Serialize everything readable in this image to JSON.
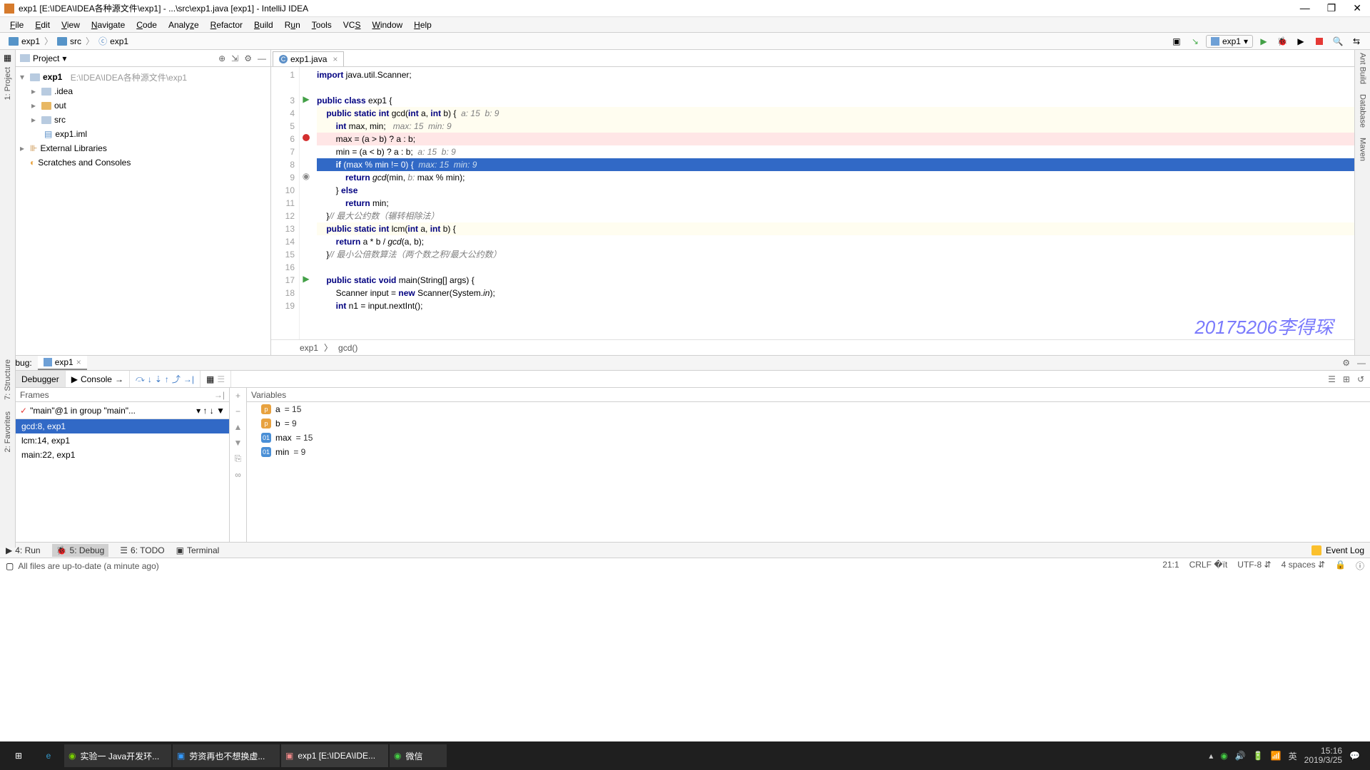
{
  "titlebar": "exp1 [E:\\IDEA\\IDEA各种源文件\\exp1] - ...\\src\\exp1.java [exp1] - IntelliJ IDEA",
  "menu": [
    "File",
    "Edit",
    "View",
    "Navigate",
    "Code",
    "Analyze",
    "Refactor",
    "Build",
    "Run",
    "Tools",
    "VCS",
    "Window",
    "Help"
  ],
  "nav": {
    "crumbs": [
      "exp1",
      "src",
      "exp1"
    ],
    "runconfig": "exp1"
  },
  "project": {
    "title": "Project",
    "root": "exp1",
    "rootPath": "E:\\IDEA\\IDEA各种源文件\\exp1",
    "children": [
      ".idea",
      "out",
      "src",
      "exp1.iml"
    ],
    "ext": [
      "External Libraries",
      "Scratches and Consoles"
    ]
  },
  "tab": "exp1.java",
  "code": {
    "lines": [
      "import java.util.Scanner;",
      "",
      "public class exp1 {",
      "    public static int gcd(int a, int b) {  a: 15  b: 9",
      "        int max, min;   max: 15  min: 9",
      "        max = (a > b) ? a : b;",
      "        min = (a < b) ? a : b;  a: 15  b: 9",
      "        if (max % min != 0) {  max: 15  min: 9",
      "            return gcd(min, b: max % min);",
      "        } else",
      "            return min;",
      "    }// 最大公约数（辗转相除法）",
      "    public static int lcm(int a, int b) {",
      "        return a * b / gcd(a, b);",
      "    }// 最小公倍数算法（两个数之积/最大公约数）",
      "",
      "    public static void main(String[] args) {",
      "        Scanner input = new Scanner(System.in);",
      "        int n1 = input.nextInt();"
    ],
    "breadcrumb": [
      "exp1",
      "gcd()"
    ]
  },
  "watermark": "20175206李得琛",
  "debug": {
    "title": "Debug:",
    "session": "exp1",
    "tabs": [
      "Debugger",
      "Console"
    ],
    "framesTitle": "Frames",
    "varsTitle": "Variables",
    "thread": "\"main\"@1 in group \"main\"...",
    "stack": [
      "gcd:8, exp1",
      "lcm:14, exp1",
      "main:22, exp1"
    ],
    "vars": [
      {
        "k": "p",
        "n": "a",
        "v": "= 15"
      },
      {
        "k": "p",
        "n": "b",
        "v": "= 9"
      },
      {
        "k": "o",
        "n": "max",
        "v": "= 15"
      },
      {
        "k": "o",
        "n": "min",
        "v": "= 9"
      }
    ]
  },
  "bottom": {
    "items": [
      "4: Run",
      "5: Debug",
      "6: TODO",
      "Terminal"
    ],
    "event": "Event Log"
  },
  "status": {
    "msg": "All files are up-to-date (a minute ago)",
    "pos": "21:1",
    "eol": "CRLF",
    "enc": "UTF-8",
    "indent": "4 spaces"
  },
  "taskbar": {
    "apps": [
      "实验一 Java开发环...",
      "劳资再也不想换虚...",
      "exp1 [E:\\IDEA\\IDE...",
      "微信"
    ],
    "ime": "英",
    "time": "15:16",
    "date": "2019/3/25"
  },
  "rightTools": [
    "Ant Build",
    "Database",
    "Maven"
  ],
  "leftTabs": [
    "1: Project"
  ],
  "leftTools": [
    "7: Structure",
    "2: Favorites"
  ]
}
